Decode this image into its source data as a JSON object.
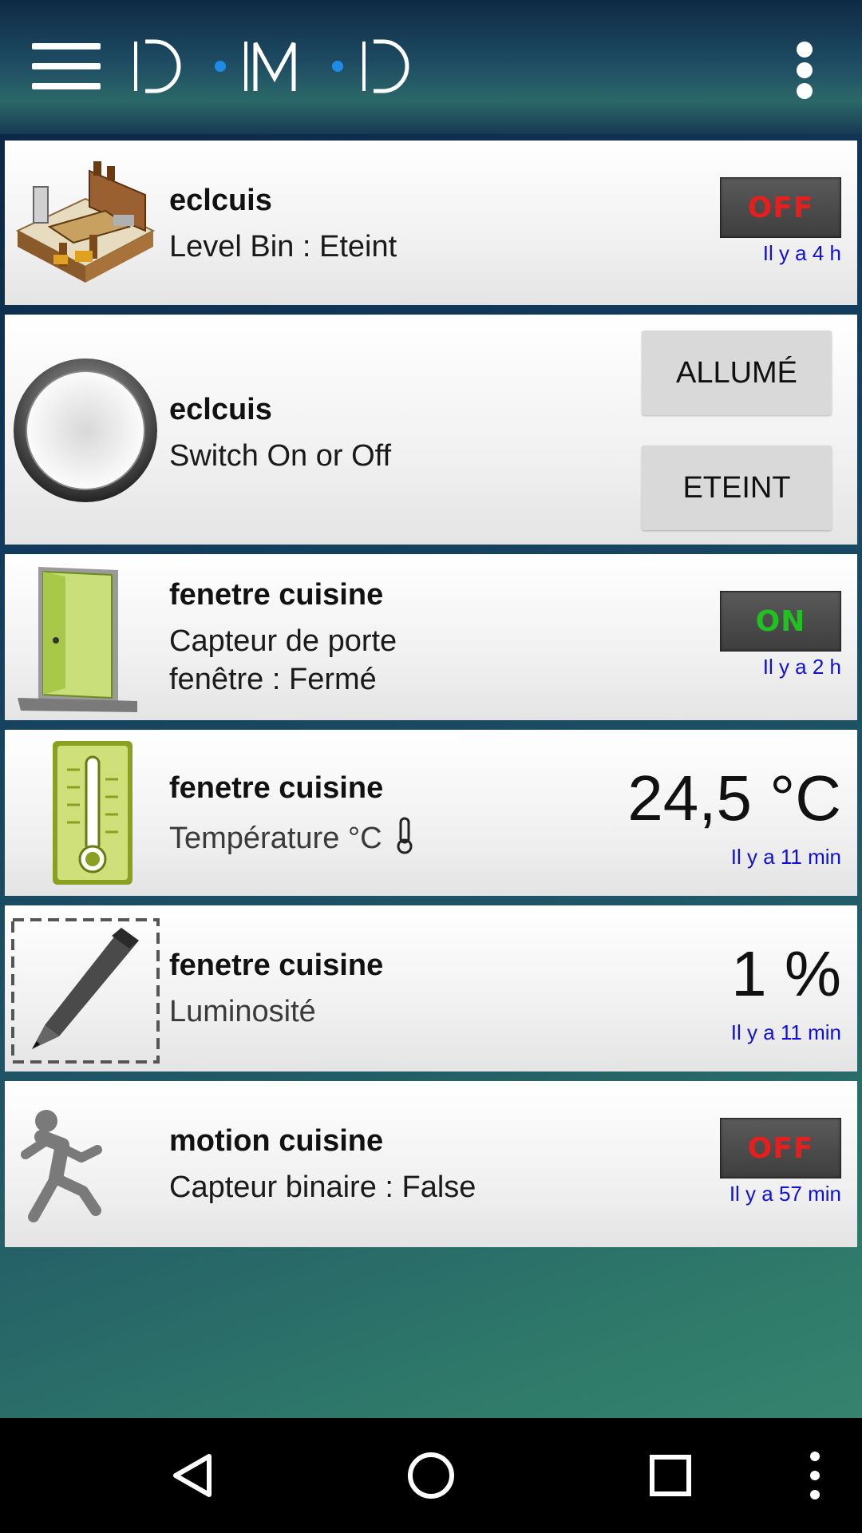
{
  "app": {
    "logo_text": "D·M·D",
    "accent": "#1010d8"
  },
  "toolbar": {
    "menu_icon": "hamburger-icon",
    "overflow_icon": "more-vert-icon"
  },
  "devices": [
    {
      "icon": "kitchen-image",
      "name": "eclcuis",
      "description": "Level Bin : Eteint",
      "state": "OFF",
      "state_color": "#e61e1e",
      "updated": "Il y a 4 h"
    },
    {
      "icon": "light-switch-image",
      "name": "eclcuis",
      "description": "Switch On or Off",
      "buttons": [
        "ALLUMÉ",
        "ETEINT"
      ]
    },
    {
      "icon": "door-image",
      "name": "fenetre cuisine",
      "description_line1": "Capteur de porte",
      "description_line2": "fenêtre : Fermé",
      "state": "ON",
      "state_color": "#1fc21f",
      "updated": "Il y a 2 h"
    },
    {
      "icon": "thermometer-image",
      "name": "fenetre cuisine",
      "description": "Température °C",
      "value": "24,5 °C",
      "updated": "Il y a 11 min"
    },
    {
      "icon": "pen-image",
      "name": "fenetre cuisine",
      "description": "Luminosité",
      "value": "1 %",
      "updated": "Il y a 11 min"
    },
    {
      "icon": "running-man-image",
      "name": "motion cuisine",
      "description": "Capteur binaire : False",
      "state": "OFF",
      "state_color": "#e61e1e",
      "updated": "Il y a 57 min"
    }
  ],
  "navigation": {
    "back_icon": "back-triangle-icon",
    "home_icon": "home-circle-icon",
    "recents_icon": "recents-square-icon",
    "menu_icon": "more-vert-icon"
  }
}
